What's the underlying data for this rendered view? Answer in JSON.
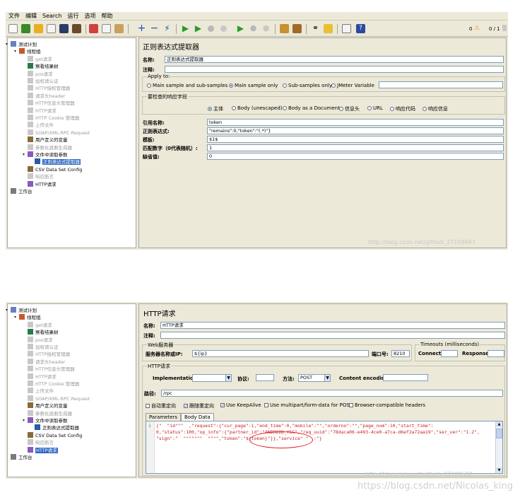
{
  "screen1": {
    "menu": [
      "文件",
      "编辑",
      "Search",
      "运行",
      "选项",
      "帮助"
    ],
    "status": {
      "warnings": "0",
      "threads": "0 / 1"
    },
    "tree": [
      {
        "label": "测试计划",
        "icon": "test-plan-icon",
        "disabled": false
      },
      {
        "label": "线程组",
        "icon": "thread-group-icon",
        "disabled": false
      },
      {
        "label": "get请求",
        "icon": "sampler-icon",
        "disabled": true
      },
      {
        "label": "察看结果树",
        "icon": "listener-icon",
        "disabled": false
      },
      {
        "label": "pos请求",
        "icon": "sampler-icon",
        "disabled": true
      },
      {
        "label": "加权请认证",
        "icon": "sampler-icon",
        "disabled": true
      },
      {
        "label": "HTTP授权管理器",
        "icon": "config-icon",
        "disabled": true
      },
      {
        "label": "请求头header",
        "icon": "config-icon",
        "disabled": true
      },
      {
        "label": "HTTP信息头管理器",
        "icon": "config-icon",
        "disabled": true
      },
      {
        "label": "HTTP请求",
        "icon": "sampler-icon",
        "disabled": true
      },
      {
        "label": "HTTP Cookie 管理器",
        "icon": "config-icon",
        "disabled": true
      },
      {
        "label": "上传文件",
        "icon": "sampler-icon",
        "disabled": true
      },
      {
        "label": "SOAP/XML-RPC Request",
        "icon": "sampler-icon",
        "disabled": true
      },
      {
        "label": "用户定义的变量",
        "icon": "config-icon",
        "disabled": false
      },
      {
        "label": "参数化遮册生成器",
        "icon": "config-icon",
        "disabled": true
      },
      {
        "label": "文件中读取参数",
        "icon": "sampler-icon",
        "disabled": false
      },
      {
        "label": "正则表达式提取器",
        "icon": "extractor-icon",
        "disabled": false,
        "selected": true
      },
      {
        "label": "CSV Data Set Config",
        "icon": "config-icon",
        "disabled": false
      },
      {
        "label": "响应断言",
        "icon": "assertion-icon",
        "disabled": true
      },
      {
        "label": "HTTP请求",
        "icon": "sampler-icon",
        "disabled": false
      },
      {
        "label": "工作台",
        "icon": "workbench-icon",
        "disabled": false
      }
    ],
    "panel": {
      "title": "正则表达式提取器",
      "name_label": "名称:",
      "name_value": "正则表达式提取器",
      "comment_label": "注释:",
      "comment_value": "",
      "apply_to_title": "Apply to:",
      "apply_to_options": [
        "Main sample and sub-samples",
        "Main sample only",
        "Sub-samples only",
        "JMeter Variable"
      ],
      "apply_to_selected": 1,
      "field_title": "要检查的响应字段",
      "field_options": [
        "主体",
        "Body (unescaped)",
        "Body as a Document",
        "信息头",
        "URL",
        "响应代码",
        "响应信息"
      ],
      "field_selected": 0,
      "ref_label": "引用名称:",
      "ref_value": "token",
      "regex_label": "正则表达式:",
      "regex_value": "\"remains\":0,\"token\":\"(.*)\"}",
      "template_label": "模板:",
      "template_value": "$1$",
      "match_label": "匹配数字（0代表随机）:",
      "match_value": "1",
      "default_label": "缺省值:",
      "default_value": "0"
    },
    "watermark": "http://blog.csdn.net/github_27109687"
  },
  "screen2": {
    "tree": [
      {
        "label": "测试计划",
        "icon": "test-plan-icon",
        "disabled": false
      },
      {
        "label": "线程组",
        "icon": "thread-group-icon",
        "disabled": false
      },
      {
        "label": "get请求",
        "icon": "sampler-icon",
        "disabled": true
      },
      {
        "label": "察看结果树",
        "icon": "listener-icon",
        "disabled": false
      },
      {
        "label": "pos请求",
        "icon": "sampler-icon",
        "disabled": true
      },
      {
        "label": "加权请认证",
        "icon": "sampler-icon",
        "disabled": true
      },
      {
        "label": "HTTP授权管理器",
        "icon": "config-icon",
        "disabled": true
      },
      {
        "label": "请求头header",
        "icon": "config-icon",
        "disabled": true
      },
      {
        "label": "HTTP信息头管理器",
        "icon": "config-icon",
        "disabled": true
      },
      {
        "label": "HTTP请求",
        "icon": "sampler-icon",
        "disabled": true
      },
      {
        "label": "HTTP Cookie 管理器",
        "icon": "config-icon",
        "disabled": true
      },
      {
        "label": "上传文件",
        "icon": "sampler-icon",
        "disabled": true
      },
      {
        "label": "SOAP/XML-RPC Request",
        "icon": "sampler-icon",
        "disabled": true
      },
      {
        "label": "用户定义的变量",
        "icon": "config-icon",
        "disabled": false
      },
      {
        "label": "参数化遮册生成器",
        "icon": "config-icon",
        "disabled": true
      },
      {
        "label": "文件中读取参数",
        "icon": "sampler-icon",
        "disabled": false
      },
      {
        "label": "正则表达式提取器",
        "icon": "extractor-icon",
        "disabled": false
      },
      {
        "label": "CSV Data Set Config",
        "icon": "config-icon",
        "disabled": false
      },
      {
        "label": "响应断言",
        "icon": "assertion-icon",
        "disabled": true
      },
      {
        "label": "HTTP请求",
        "icon": "sampler-icon",
        "disabled": false,
        "selected": true
      },
      {
        "label": "工作台",
        "icon": "workbench-icon",
        "disabled": false
      }
    ],
    "panel": {
      "title": "HTTP请求",
      "name_label": "名称:",
      "name_value": "HTTP请求",
      "comment_label": "注释:",
      "web_server_title": "Web服务器",
      "server_label": "服务器名称或IP:",
      "server_value": "${ip}",
      "port_label": "端口号:",
      "port_value": "8210",
      "timeouts_title": "Timeouts (milliseconds)",
      "connect_label": "Connect:",
      "response_label": "Response:",
      "http_request_title": "HTTP请求",
      "impl_label": "Implementation:",
      "protocol_label": "协议:",
      "method_label": "方法:",
      "method_value": "POST",
      "encoding_label": "Content encoding:",
      "path_label": "路径:",
      "path_value": "/rpc",
      "options": [
        {
          "label": "自动重定向",
          "checked": false
        },
        {
          "label": "跟随重定向",
          "checked": true
        },
        {
          "label": "Use KeepAlive",
          "checked": true
        },
        {
          "label": "Use multipart/form-data for POST",
          "checked": false
        },
        {
          "label": "Browser-compatible headers",
          "checked": false
        }
      ],
      "tabs": [
        "Parameters",
        "Body Data"
      ],
      "active_tab": 1,
      "line_number": "1",
      "body_lines": [
        "{\"  \"id\"\"\"  ,\"request\":{\"cur_page\":1,\"end_time\":0,\"mobile\":\"\",\"orderno\":\"\",\"page_num\":10,\"start_time\":",
        "0,\"status\":100,\"op_info\":{\"partner_id\":\"ANDROID_YSC\",\"req_uuid\":\"78daca06-e493-4ce0-a7ca-d6ef2a72aa19\",\"ser_ver\":\"1.2\",",
        "\"sign\":\"  \"\"\"\"\"\"\"  \"\"\"\",\"token\":\"${token}\"}},\"service\" \"  :\"}"
      ]
    },
    "watermark": "http://blog.csdn.net/github_27109687",
    "watermark2": "https://blog.csdn.net/Nicolas_king"
  },
  "colors": {
    "window_bg": "#ece9d8",
    "selection": "#316ac5",
    "annotation": "#e02020"
  }
}
